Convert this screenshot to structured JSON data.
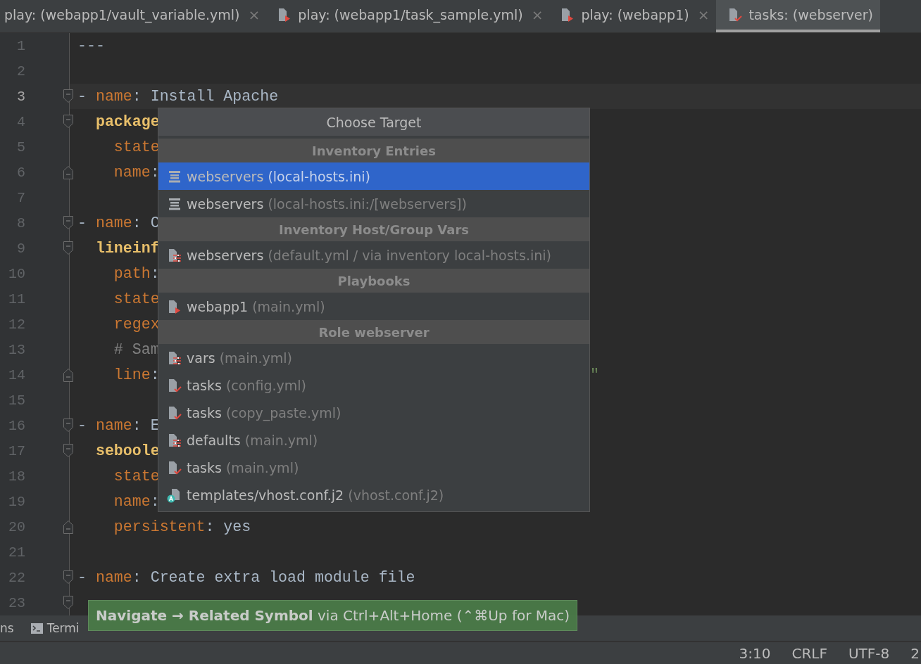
{
  "tabs": [
    {
      "label": "play: (webapp1/vault_variable.yml)",
      "kind": "plain",
      "selected": false,
      "close": "×"
    },
    {
      "label": "play: (webapp1/task_sample.yml)",
      "kind": "play",
      "selected": false,
      "close": "×"
    },
    {
      "label": "play: (webapp1)",
      "kind": "play",
      "selected": false,
      "close": "×"
    },
    {
      "label": "tasks: (webserver)",
      "kind": "tasks",
      "selected": true
    }
  ],
  "editor": {
    "lines": [
      {
        "number": "1",
        "current": false,
        "tokens": [
          {
            "kind": "docsep",
            "text": "---"
          }
        ]
      },
      {
        "number": "2",
        "current": false
      },
      {
        "number": "3",
        "current": true,
        "kind": "start",
        "tokens": [
          {
            "kind": "dash",
            "text": "- "
          },
          {
            "kind": "key",
            "text": "name"
          },
          {
            "kind": "punct",
            "text": ": "
          },
          {
            "kind": "value",
            "text": "Install Apache"
          }
        ]
      },
      {
        "number": "4",
        "current": false,
        "kind": "start",
        "tokens": [
          {
            "kind": "section",
            "text": "  package"
          }
        ]
      },
      {
        "number": "5",
        "current": false,
        "tokens": [
          {
            "kind": "key",
            "text": "    state"
          }
        ]
      },
      {
        "number": "6",
        "current": false,
        "kind": "end",
        "tokens": [
          {
            "kind": "key",
            "text": "    name"
          },
          {
            "kind": "punct",
            "text": ":"
          }
        ]
      },
      {
        "number": "7",
        "current": false
      },
      {
        "number": "8",
        "current": false,
        "kind": "start",
        "tokens": [
          {
            "kind": "dash",
            "text": "- "
          },
          {
            "kind": "key",
            "text": "name"
          },
          {
            "kind": "punct",
            "text": ": "
          },
          {
            "kind": "value",
            "text": "C"
          }
        ]
      },
      {
        "number": "9",
        "current": false,
        "kind": "start",
        "tokens": [
          {
            "kind": "section",
            "text": "  lineinf"
          }
        ]
      },
      {
        "number": "10",
        "current": false,
        "tokens": [
          {
            "kind": "key",
            "text": "    path"
          },
          {
            "kind": "punct",
            "text": ":"
          }
        ]
      },
      {
        "number": "11",
        "current": false,
        "tokens": [
          {
            "kind": "key",
            "text": "    state"
          }
        ]
      },
      {
        "number": "12",
        "current": false,
        "tokens": [
          {
            "kind": "key",
            "text": "    regex"
          }
        ]
      },
      {
        "number": "13",
        "current": false,
        "tokens": [
          {
            "kind": "comment",
            "text": "    # Sam"
          }
        ]
      },
      {
        "number": "14",
        "current": false,
        "kind": "end",
        "tokens": [
          {
            "kind": "key",
            "text": "    line"
          },
          {
            "kind": "punct",
            "text": ":"
          }
        ],
        "tail": "\""
      },
      {
        "number": "15",
        "current": false
      },
      {
        "number": "16",
        "current": false,
        "kind": "start",
        "tokens": [
          {
            "kind": "dash",
            "text": "- "
          },
          {
            "kind": "key",
            "text": "name"
          },
          {
            "kind": "punct",
            "text": ": "
          },
          {
            "kind": "value",
            "text": "E"
          }
        ]
      },
      {
        "number": "17",
        "current": false,
        "kind": "start",
        "tokens": [
          {
            "kind": "section",
            "text": "  seboole"
          }
        ]
      },
      {
        "number": "18",
        "current": false,
        "tokens": [
          {
            "kind": "key",
            "text": "    state"
          }
        ]
      },
      {
        "number": "19",
        "current": false,
        "tokens": [
          {
            "kind": "key",
            "text": "    name"
          },
          {
            "kind": "punct",
            "text": ":"
          }
        ]
      },
      {
        "number": "20",
        "current": false,
        "kind": "end",
        "tokens": [
          {
            "kind": "key",
            "text": "    persistent"
          },
          {
            "kind": "punct",
            "text": ": "
          },
          {
            "kind": "value",
            "text": "yes"
          }
        ]
      },
      {
        "number": "21",
        "current": false
      },
      {
        "number": "22",
        "current": false,
        "kind": "start",
        "tokens": [
          {
            "kind": "dash",
            "text": "- "
          },
          {
            "kind": "key",
            "text": "name"
          },
          {
            "kind": "punct",
            "text": ": "
          },
          {
            "kind": "value",
            "text": "Create extra load module file"
          }
        ]
      },
      {
        "number": "23",
        "current": false,
        "kind": "start"
      }
    ]
  },
  "popup": {
    "title": "Choose Target",
    "sections": [
      {
        "title": "Inventory Entries",
        "items": [
          {
            "name": "webservers",
            "detail": "(local-hosts.ini)",
            "kind": "host",
            "selected": true
          },
          {
            "name": "webservers",
            "detail": "(local-hosts.ini:/[webservers])",
            "kind": "host",
            "selected": false
          }
        ]
      },
      {
        "title": "Inventory Host/Group Vars",
        "items": [
          {
            "name": "webservers",
            "detail": "(default.yml / via inventory local-hosts.ini)",
            "kind": "vars",
            "selected": false
          }
        ]
      },
      {
        "title": "Playbooks",
        "items": [
          {
            "name": "webapp1",
            "detail": "(main.yml)",
            "kind": "play",
            "selected": false
          }
        ]
      },
      {
        "title": "Role webserver",
        "items": [
          {
            "name": "vars",
            "detail": "(main.yml)",
            "kind": "vars",
            "selected": false
          },
          {
            "name": "tasks",
            "detail": "(config.yml)",
            "kind": "tasks",
            "selected": false
          },
          {
            "name": "tasks",
            "detail": "(copy_paste.yml)",
            "kind": "tasks",
            "selected": false
          },
          {
            "name": "defaults",
            "detail": "(main.yml)",
            "kind": "vars",
            "selected": false
          },
          {
            "name": "tasks",
            "detail": "(main.yml)",
            "kind": "tasks",
            "selected": false
          },
          {
            "name": "templates/vhost.conf.j2",
            "detail": "(vhost.conf.j2)",
            "kind": "template",
            "selected": false
          }
        ]
      }
    ]
  },
  "hint": "**Navigate → Related Symbol** via Ctrl+Alt+Home (⌃⌘Up for Mac)",
  "tool_strip": [
    {
      "label": "ns",
      "kind": "plain"
    },
    {
      "label": "Termi",
      "kind": "terminal"
    }
  ],
  "status_bar": [
    "3:10",
    "CRLF",
    "UTF-8",
    "2"
  ]
}
